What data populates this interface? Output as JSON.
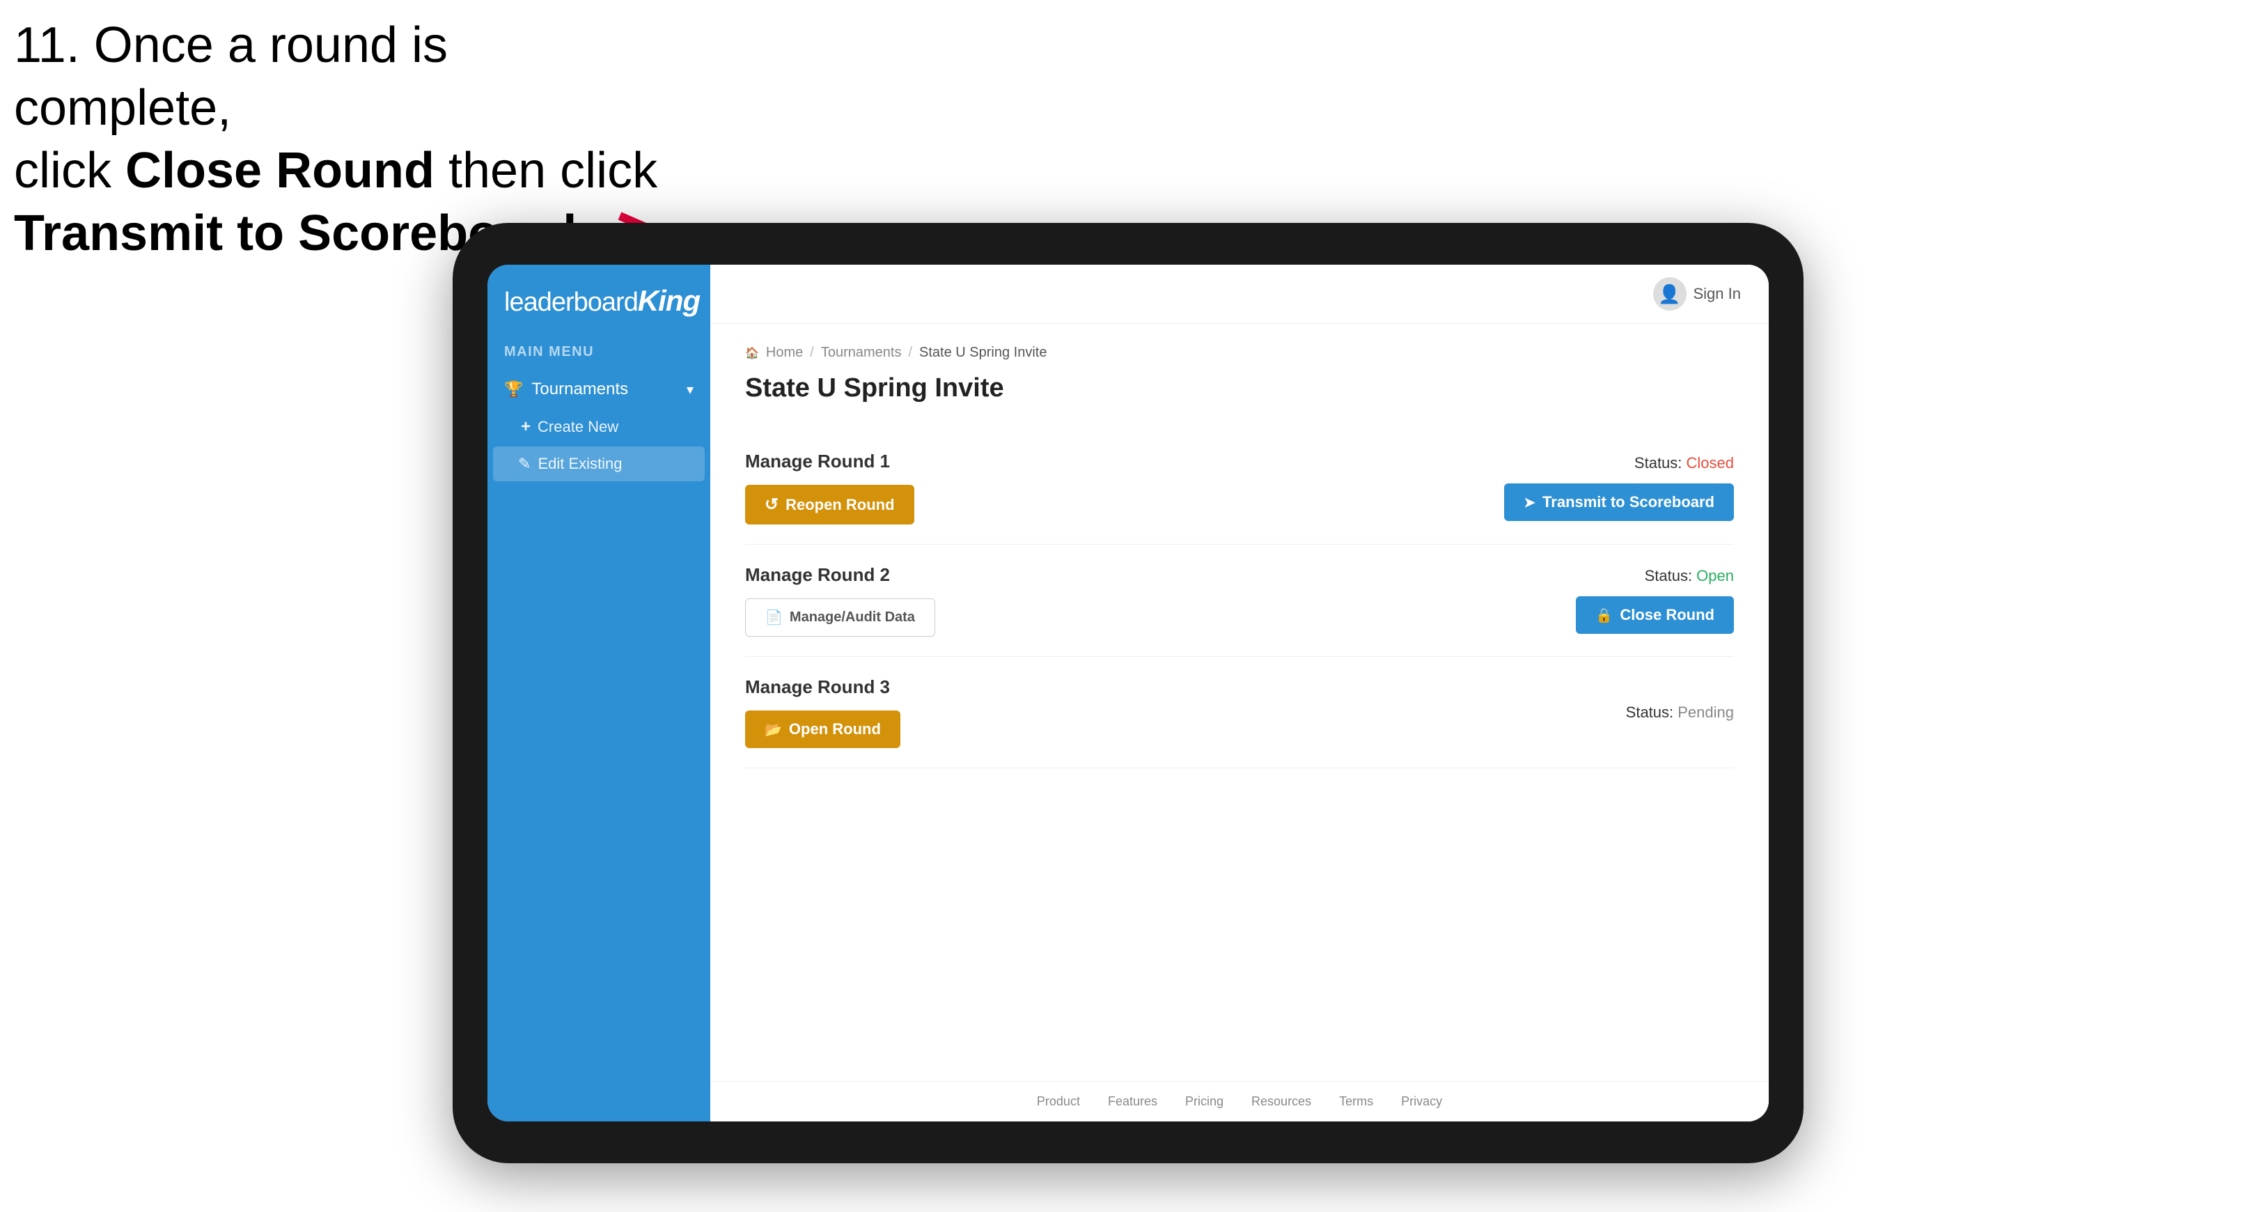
{
  "instruction": {
    "line1": "11. Once a round is complete,",
    "line2": "click ",
    "bold1": "Close Round",
    "line3": " then click",
    "bold2": "Transmit to Scoreboard."
  },
  "header": {
    "sign_in_label": "Sign In"
  },
  "breadcrumb": {
    "home": "Home",
    "separator1": "/",
    "tournaments": "Tournaments",
    "separator2": "/",
    "current": "State U Spring Invite"
  },
  "page": {
    "title": "State U Spring Invite"
  },
  "sidebar": {
    "logo_leaderboard": "leaderboard",
    "logo_king": "King",
    "main_menu_label": "MAIN MENU",
    "nav_items": [
      {
        "label": "Tournaments",
        "has_chevron": true
      }
    ],
    "sub_items": [
      {
        "label": "Create New",
        "icon": "plus"
      },
      {
        "label": "Edit Existing",
        "icon": "edit",
        "active": true
      }
    ]
  },
  "rounds": [
    {
      "id": "round1",
      "title": "Manage Round 1",
      "status_label": "Status:",
      "status_value": "Closed",
      "status_class": "status-closed",
      "buttons": [
        {
          "label": "Reopen Round",
          "style": "btn-amber",
          "icon": "reopen"
        },
        {
          "label": "Transmit to Scoreboard",
          "style": "btn-blue",
          "icon": "transmit"
        }
      ]
    },
    {
      "id": "round2",
      "title": "Manage Round 2",
      "status_label": "Status:",
      "status_value": "Open",
      "status_class": "status-open",
      "buttons": [
        {
          "label": "Manage/Audit Data",
          "style": "btn-outline",
          "icon": "doc"
        },
        {
          "label": "Close Round",
          "style": "btn-blue",
          "icon": "close"
        }
      ]
    },
    {
      "id": "round3",
      "title": "Manage Round 3",
      "status_label": "Status:",
      "status_value": "Pending",
      "status_class": "status-pending",
      "buttons": [
        {
          "label": "Open Round",
          "style": "btn-amber",
          "icon": "open"
        }
      ]
    }
  ],
  "footer": {
    "links": [
      "Product",
      "Features",
      "Pricing",
      "Resources",
      "Terms",
      "Privacy"
    ]
  },
  "colors": {
    "sidebar_bg": "#2d8fd4",
    "amber": "#d4910a",
    "blue": "#2d8fd4",
    "closed_red": "#e74c3c",
    "open_green": "#27ae60"
  }
}
